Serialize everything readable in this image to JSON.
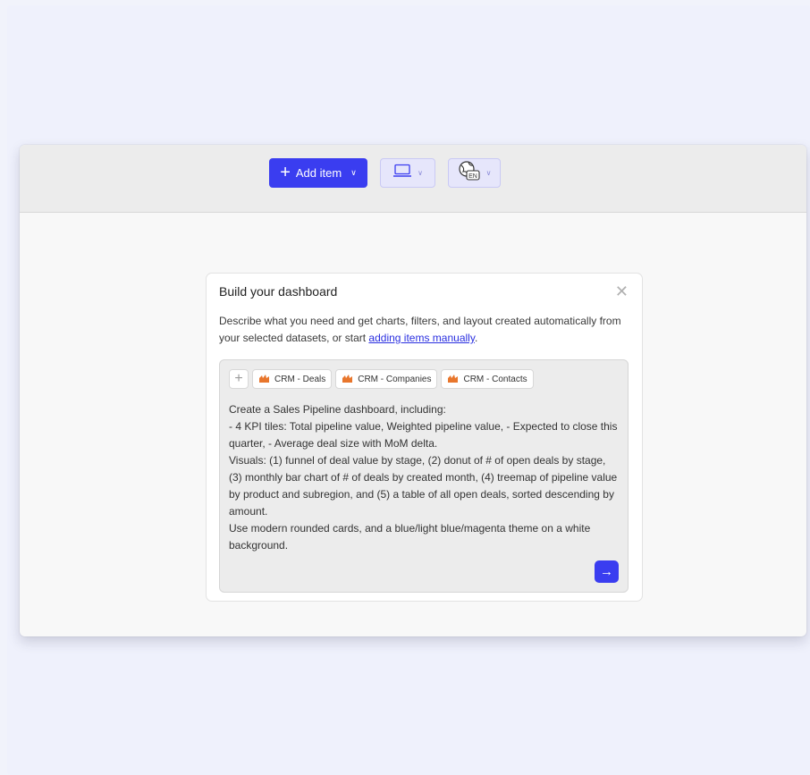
{
  "toolbar": {
    "add_item_label": "Add item",
    "language_code": "EN"
  },
  "dialog": {
    "title": "Build your dashboard",
    "description_prefix": "Describe what you need and get charts, filters, and layout created automatically from your selected datasets, or start ",
    "description_link": "adding items manually",
    "description_suffix": ".",
    "datasets": [
      {
        "label": "CRM - Deals"
      },
      {
        "label": "CRM - Companies"
      },
      {
        "label": "CRM - Contacts"
      }
    ],
    "prompt": "Create a Sales Pipeline dashboard, including:\n- 4 KPI tiles: Total pipeline value, Weighted pipeline value, - Expected to close this quarter, - Average deal size with MoM delta.\nVisuals: (1) funnel of deal value by stage, (2) donut of # of open deals by stage, (3) monthly bar chart of # of deals by created month, (4) treemap of pipeline value by product and subregion, and (5) a table of all open deals, sorted descending by amount.\nUse modern rounded cards, and a blue/light blue/magenta theme on a white background."
  },
  "colors": {
    "accent": "#3a3df0",
    "dataset_icon": "#e8762c"
  },
  "icons": {
    "add": "plus-icon",
    "dropdown": "chevron-down-icon",
    "device": "laptop-icon",
    "language": "globe-language-icon",
    "close": "close-icon",
    "dataset": "dataset-logo-icon",
    "send": "arrow-right-icon"
  }
}
